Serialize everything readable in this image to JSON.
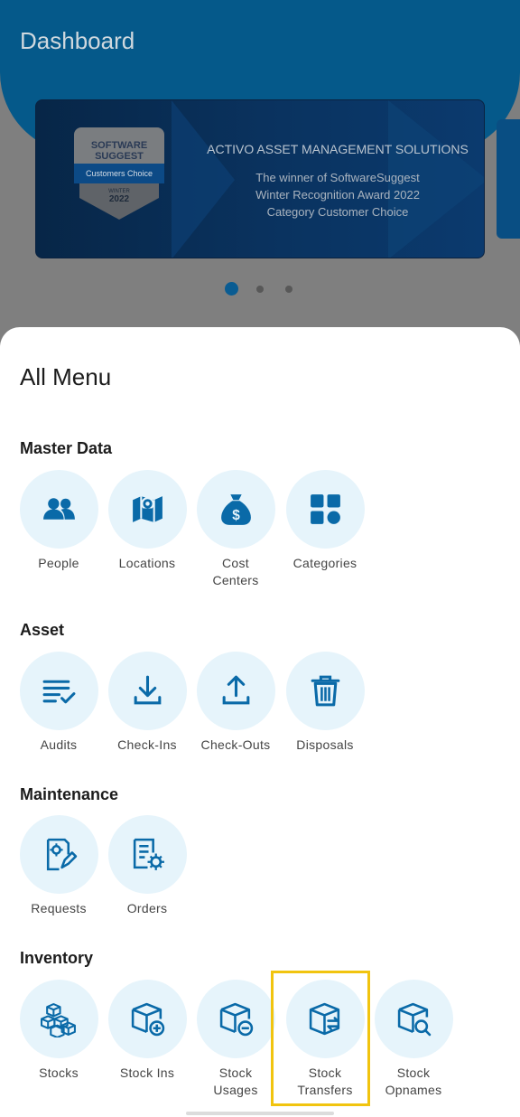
{
  "header": {
    "title": "Dashboard"
  },
  "banner": {
    "badge": {
      "brand": "SOFTWARE SUGGEST",
      "ribbon": "Customers Choice",
      "season": "WINTER",
      "year": "2022"
    },
    "heading": "ACTIVO ASSET MANAGEMENT SOLUTIONS",
    "body": [
      "The winner of SoftwareSuggest",
      "Winter Recognition Award 2022",
      "Category Customer Choice"
    ],
    "pager": {
      "count": 3,
      "active": 0
    }
  },
  "sheet": {
    "title": "All Menu",
    "sections": [
      {
        "title": "Master Data",
        "items": [
          {
            "label": "People",
            "icon": "people-icon"
          },
          {
            "label": "Locations",
            "icon": "map-icon"
          },
          {
            "label": "Cost\nCenters",
            "icon": "money-bag-icon"
          },
          {
            "label": "Categories",
            "icon": "categories-icon"
          }
        ]
      },
      {
        "title": "Asset",
        "items": [
          {
            "label": "Audits",
            "icon": "checklist-icon"
          },
          {
            "label": "Check-Ins",
            "icon": "download-icon"
          },
          {
            "label": "Check-Outs",
            "icon": "upload-icon"
          },
          {
            "label": "Disposals",
            "icon": "trash-icon"
          }
        ]
      },
      {
        "title": "Maintenance",
        "items": [
          {
            "label": "Requests",
            "icon": "request-edit-icon"
          },
          {
            "label": "Orders",
            "icon": "order-settings-icon"
          }
        ]
      },
      {
        "title": "Inventory",
        "items": [
          {
            "label": "Stocks",
            "icon": "boxes-icon"
          },
          {
            "label": "Stock Ins",
            "icon": "box-plus-icon"
          },
          {
            "label": "Stock\nUsages",
            "icon": "box-minus-icon"
          },
          {
            "label": "Stock\nTransfers",
            "icon": "box-transfer-icon",
            "highlighted": true
          },
          {
            "label": "Stock\nOpnames",
            "icon": "box-search-icon"
          }
        ]
      }
    ]
  },
  "colors": {
    "accent": "#0a6aa8",
    "icon_bg": "#e6f4fb",
    "highlight": "#f1c40f",
    "header": "#05598a"
  }
}
